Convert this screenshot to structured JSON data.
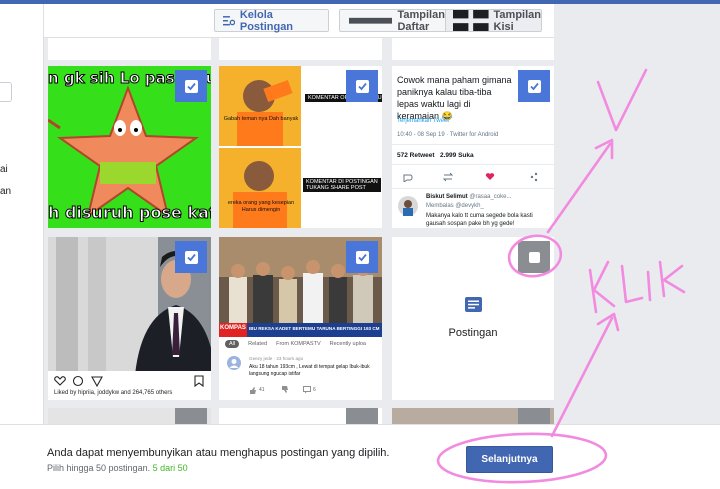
{
  "toolbar": {
    "manage_label": "Kelola Postingan",
    "list_view_label": "Tampilan Daftar",
    "grid_view_label": "Tampilan Kisi"
  },
  "left_panel": {
    "text_1": "ai",
    "text_2": "an"
  },
  "tiles": {
    "meme_patrick": {
      "caption_top": "n gk sih Lo pas mau",
      "caption_bottom": "h disuruh pose kaf",
      "selected": true
    },
    "meme_drake": {
      "label_top": "KOMENTAR ORANG FAMOUS",
      "text_top": "Gabah teman nya Dah banyak",
      "label_bottom": "KOMENTAR DI POSTINGAN TUKANG SHARE POST",
      "text_bottom": "ereka orang yang kesepian Harus dimengin",
      "selected": true
    },
    "tweet": {
      "text": "Cowok mana paham gimana paniknya kalau tiba-tiba lepas waktu lagi di keramaian 😂",
      "translate": "Terjemahkan Tweet",
      "meta": "10:40 - 08 Sep 19 · Twitter for Android",
      "retweets": "572 Retweet",
      "likes": "2.999 Suka",
      "reply_name": "Biskut Selimut",
      "reply_handle": "@rasaa_coke...",
      "reply_to": "Membalas @devykh_",
      "reply_text": "Makanya kalo tt cuma segede bola kasti gausah sospan pake bh yg gede!",
      "selected": true
    },
    "portrait": {
      "liked_by": "Liked by hipriia, joddykw and 264,765 others",
      "selected": true
    },
    "news": {
      "ticker": "IBU REKSA KADET BERTEMU TARUNA BERTINGGI 193 CM",
      "brand": "KOMPAS",
      "tabs": [
        "All",
        "Related",
        "From KOMPASTV",
        "Recently uploa"
      ],
      "comment_user": "Geezy jede · 23 hours ago",
      "comment_text": "Aku 18 tahun 193cm , Lewat di tempat gelap Ibuk-ibuk langsung ngucap istifar",
      "likes": "41",
      "replies": "6",
      "selected": true
    },
    "post": {
      "label": "Postingan",
      "selected": false
    }
  },
  "footer": {
    "message": "Anda dapat menyembunyikan atau menghapus postingan yang dipilih.",
    "limit_text": "Pilih hingga 50 postingan.",
    "count_text": "5 dari 50",
    "next_label": "Selanjutnya"
  },
  "annotation": {
    "handwritten": "KLIK",
    "checkmark": "✓"
  },
  "colors": {
    "facebook_blue": "#4267b2",
    "check_blue": "#4a76d9",
    "annotation_pink": "#f28be0",
    "green_count": "#42b72a"
  }
}
